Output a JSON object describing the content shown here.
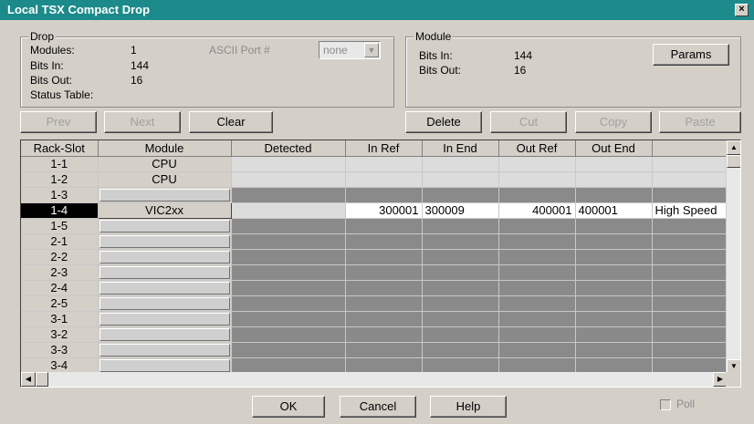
{
  "window": {
    "title": "Local TSX Compact Drop",
    "close_label": "×"
  },
  "drop": {
    "group_title": "Drop",
    "modules_label": "Modules:",
    "modules_value": "1",
    "bits_in_label": "Bits In:",
    "bits_in_value": "144",
    "bits_out_label": "Bits Out:",
    "bits_out_value": "16",
    "status_table_label": "Status Table:",
    "ascii_port_label": "ASCII Port #",
    "ascii_port_value": "none"
  },
  "module": {
    "group_title": "Module",
    "bits_in_label": "Bits In:",
    "bits_in_value": "144",
    "bits_out_label": "Bits Out:",
    "bits_out_value": "16",
    "params_label": "Params"
  },
  "toolbar": {
    "prev": "Prev",
    "next": "Next",
    "clear": "Clear",
    "delete": "Delete",
    "cut": "Cut",
    "copy": "Copy",
    "paste": "Paste"
  },
  "grid": {
    "columns": [
      "Rack-Slot",
      "Module",
      "Detected",
      "In Ref",
      "In End",
      "Out Ref",
      "Out End",
      ""
    ],
    "rows": [
      {
        "slot": "1-1",
        "module": "CPU",
        "detected": "",
        "in_ref": "",
        "in_end": "",
        "out_ref": "",
        "out_end": "",
        "desc": "",
        "style": "light"
      },
      {
        "slot": "1-2",
        "module": "CPU",
        "detected": "",
        "in_ref": "",
        "in_end": "",
        "out_ref": "",
        "out_end": "",
        "desc": "",
        "style": "light"
      },
      {
        "slot": "1-3",
        "module": "",
        "detected": "",
        "in_ref": "",
        "in_end": "",
        "out_ref": "",
        "out_end": "",
        "desc": "",
        "style": "dark"
      },
      {
        "slot": "1-4",
        "module": "VIC2xx",
        "detected": "",
        "in_ref": "300001",
        "in_end": "300009",
        "out_ref": "400001",
        "out_end": "400001",
        "desc": "High Speed",
        "style": "active"
      },
      {
        "slot": "1-5",
        "module": "",
        "detected": "",
        "in_ref": "",
        "in_end": "",
        "out_ref": "",
        "out_end": "",
        "desc": "",
        "style": "dark"
      },
      {
        "slot": "2-1",
        "module": "",
        "detected": "",
        "in_ref": "",
        "in_end": "",
        "out_ref": "",
        "out_end": "",
        "desc": "",
        "style": "dark"
      },
      {
        "slot": "2-2",
        "module": "",
        "detected": "",
        "in_ref": "",
        "in_end": "",
        "out_ref": "",
        "out_end": "",
        "desc": "",
        "style": "dark"
      },
      {
        "slot": "2-3",
        "module": "",
        "detected": "",
        "in_ref": "",
        "in_end": "",
        "out_ref": "",
        "out_end": "",
        "desc": "",
        "style": "dark"
      },
      {
        "slot": "2-4",
        "module": "",
        "detected": "",
        "in_ref": "",
        "in_end": "",
        "out_ref": "",
        "out_end": "",
        "desc": "",
        "style": "dark"
      },
      {
        "slot": "2-5",
        "module": "",
        "detected": "",
        "in_ref": "",
        "in_end": "",
        "out_ref": "",
        "out_end": "",
        "desc": "",
        "style": "dark"
      },
      {
        "slot": "3-1",
        "module": "",
        "detected": "",
        "in_ref": "",
        "in_end": "",
        "out_ref": "",
        "out_end": "",
        "desc": "",
        "style": "dark"
      },
      {
        "slot": "3-2",
        "module": "",
        "detected": "",
        "in_ref": "",
        "in_end": "",
        "out_ref": "",
        "out_end": "",
        "desc": "",
        "style": "dark"
      },
      {
        "slot": "3-3",
        "module": "",
        "detected": "",
        "in_ref": "",
        "in_end": "",
        "out_ref": "",
        "out_end": "",
        "desc": "",
        "style": "dark"
      },
      {
        "slot": "3-4",
        "module": "",
        "detected": "",
        "in_ref": "",
        "in_end": "",
        "out_ref": "",
        "out_end": "",
        "desc": "",
        "style": "dark"
      }
    ],
    "selected_slot": "1-4"
  },
  "footer": {
    "ok": "OK",
    "cancel": "Cancel",
    "help": "Help",
    "poll_label": "Poll"
  },
  "colors": {
    "titlebar": "#1c8a8a",
    "window_bg": "#d4d0c8",
    "empty_cell": "#8a8a8a"
  }
}
